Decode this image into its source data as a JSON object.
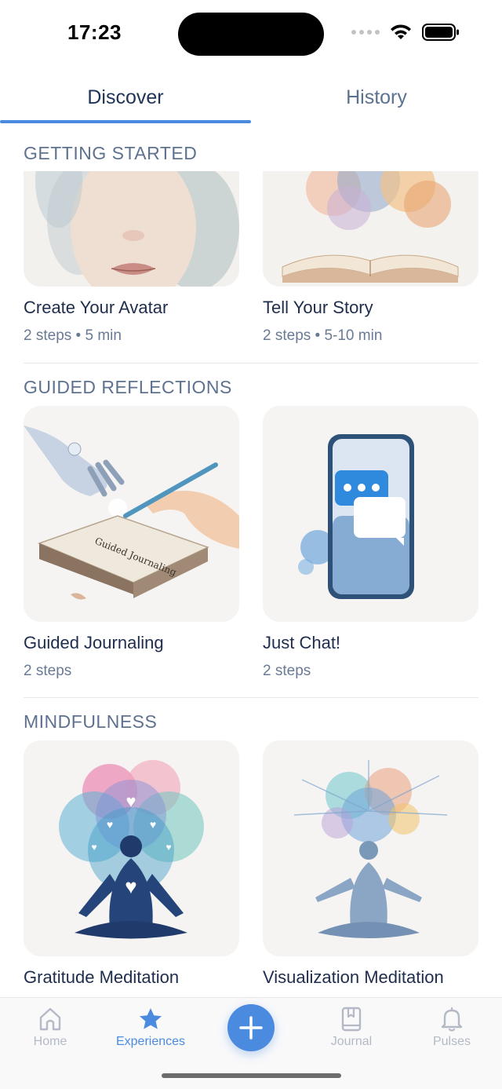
{
  "status_bar": {
    "time": "17:23"
  },
  "tabs": [
    {
      "label": "Discover",
      "active": true
    },
    {
      "label": "History",
      "active": false
    }
  ],
  "sections": [
    {
      "title": "GETTING STARTED",
      "cards": [
        {
          "title": "Create Your Avatar",
          "meta": "2 steps • 5 min",
          "image": "watercolor-face-illustration"
        },
        {
          "title": "Tell Your Story",
          "meta": "2 steps • 5-10 min",
          "image": "watercolor-open-book-illustration"
        }
      ]
    },
    {
      "title": "GUIDED REFLECTIONS",
      "cards": [
        {
          "title": "Guided Journaling",
          "meta": "2 steps",
          "image": "robot-hand-journal-illustration",
          "image_text": "Guided Journaling"
        },
        {
          "title": "Just Chat!",
          "meta": "2 steps",
          "image": "phone-chat-bubbles-illustration"
        }
      ]
    },
    {
      "title": "MINDFULNESS",
      "cards": [
        {
          "title": "Gratitude Meditation",
          "image": "meditating-person-hearts-illustration"
        },
        {
          "title": "Visualization Meditation",
          "image": "meditating-person-splash-illustration"
        }
      ]
    }
  ],
  "bottom_nav": [
    {
      "label": "Home",
      "icon": "home-icon",
      "active": false
    },
    {
      "label": "Experiences",
      "icon": "star-icon",
      "active": true
    },
    {
      "label": "",
      "icon": "plus-icon",
      "active": false
    },
    {
      "label": "Journal",
      "icon": "journal-icon",
      "active": false
    },
    {
      "label": "Pulses",
      "icon": "bell-icon",
      "active": false
    }
  ],
  "colors": {
    "accent": "#4a8be0",
    "text_dark": "#1f2d4d",
    "text_muted": "#697a95"
  }
}
